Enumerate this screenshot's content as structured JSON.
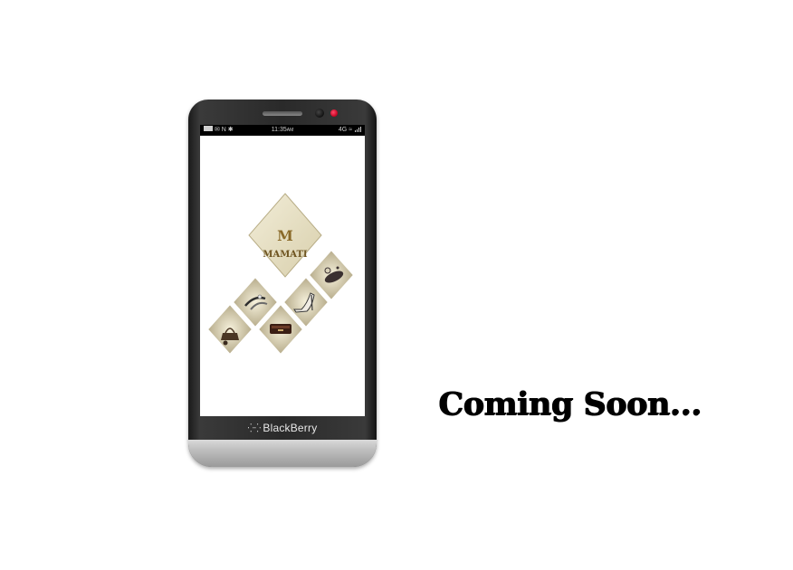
{
  "device": {
    "brand_name": "BlackBerry",
    "brand_logo_icon": "blackberry-logo-icon",
    "led_color": "#e0002a"
  },
  "statusbar": {
    "left_indicators": "N",
    "time": "11:35",
    "time_suffix": "AM",
    "network": "4G"
  },
  "app": {
    "logo_monogram": "M",
    "logo_name": "MAMATI",
    "products": [
      "handbag-icon",
      "sandal-icon",
      "wallet-icon",
      "high-heel-shoe-icon",
      "clutch-icon"
    ],
    "accent_color": "#8a6a2a",
    "tile_color": "#e8e2c8"
  },
  "message": {
    "text": "Coming Soon..."
  }
}
